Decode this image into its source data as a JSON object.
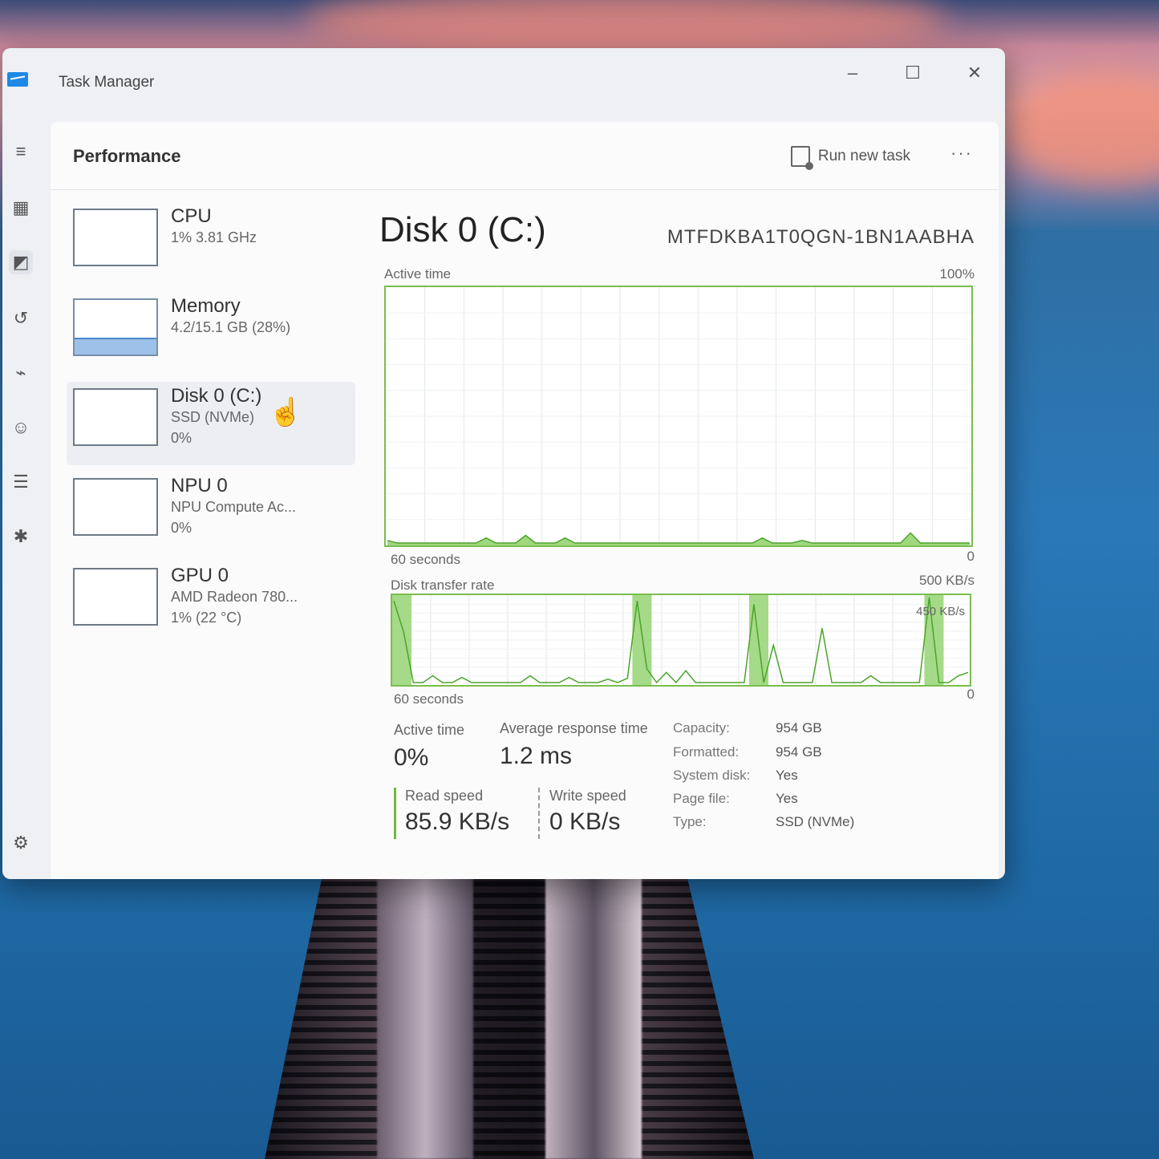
{
  "window": {
    "title": "Task Manager",
    "min_icon": "minimize-icon",
    "max_icon": "maximize-icon",
    "close_icon": "close-icon"
  },
  "nav": {
    "icons": [
      "hamburger-icon",
      "processes-icon",
      "performance-icon",
      "app-history-icon",
      "startup-icon",
      "users-icon",
      "details-icon",
      "services-icon"
    ],
    "settings_icon": "settings-icon"
  },
  "header": {
    "title": "Performance",
    "run_task_label": "Run new task",
    "more_label": "···"
  },
  "devices": [
    {
      "name": "CPU",
      "sub": "1% 3.81 GHz",
      "val": ""
    },
    {
      "name": "Memory",
      "sub": "4.2/15.1 GB (28%)",
      "val": "",
      "fill": 0.28
    },
    {
      "name": "Disk 0 (C:)",
      "sub": "SSD (NVMe)",
      "val": "0%"
    },
    {
      "name": "NPU 0",
      "sub": "NPU Compute Ac...",
      "val": "0%"
    },
    {
      "name": "GPU 0",
      "sub": "AMD Radeon 780...",
      "val": "1% (22 °C)"
    }
  ],
  "detail": {
    "title": "Disk 0 (C:)",
    "model": "MTFDKBA1T0QGN-1BN1AABHA",
    "chart1": {
      "label": "Active time",
      "max": "100%",
      "time": "60 seconds",
      "min": "0"
    },
    "chart2": {
      "label": "Disk transfer rate",
      "max": "500 KB/s",
      "mid": "450 KB/s",
      "time": "60 seconds",
      "min": "0"
    },
    "stats": {
      "active_label": "Active time",
      "active_value": "0%",
      "resp_label": "Average response time",
      "resp_value": "1.2 ms",
      "read_label": "Read speed",
      "read_value": "85.9 KB/s",
      "write_label": "Write speed",
      "write_value": "0 KB/s"
    },
    "props": [
      {
        "k": "Capacity:",
        "v": "954 GB"
      },
      {
        "k": "Formatted:",
        "v": "954 GB"
      },
      {
        "k": "System disk:",
        "v": "Yes"
      },
      {
        "k": "Page file:",
        "v": "Yes"
      },
      {
        "k": "Type:",
        "v": "SSD (NVMe)"
      }
    ]
  },
  "chart_data": [
    {
      "type": "area",
      "title": "Active time",
      "ylim": [
        0,
        100
      ],
      "x": [
        0,
        1,
        2,
        3,
        4,
        5,
        6,
        7,
        8,
        9,
        10,
        11,
        12,
        13,
        14,
        15,
        16,
        17,
        18,
        19,
        20,
        21,
        22,
        23,
        24,
        25,
        26,
        27,
        28,
        29,
        30,
        31,
        32,
        33,
        34,
        35,
        36,
        37,
        38,
        39,
        40,
        41,
        42,
        43,
        44,
        45,
        46,
        47,
        48,
        49,
        50,
        51,
        52,
        53,
        54,
        55,
        56,
        57,
        58,
        59
      ],
      "series": [
        {
          "values": [
            1,
            0,
            0,
            0,
            0,
            0,
            0,
            0,
            0,
            0,
            2,
            0,
            0,
            0,
            3,
            0,
            0,
            0,
            2,
            0,
            0,
            0,
            0,
            0,
            0,
            0,
            0,
            0,
            0,
            0,
            0,
            0,
            0,
            0,
            0,
            0,
            0,
            0,
            2,
            0,
            0,
            0,
            1,
            0,
            0,
            0,
            0,
            0,
            0,
            0,
            0,
            0,
            0,
            4,
            0,
            0,
            0,
            0,
            0,
            0
          ]
        }
      ]
    },
    {
      "type": "line",
      "title": "Disk transfer rate",
      "ylim": [
        0,
        500
      ],
      "x": [
        0,
        1,
        2,
        3,
        4,
        5,
        6,
        7,
        8,
        9,
        10,
        11,
        12,
        13,
        14,
        15,
        16,
        17,
        18,
        19,
        20,
        21,
        22,
        23,
        24,
        25,
        26,
        27,
        28,
        29,
        30,
        31,
        32,
        33,
        34,
        35,
        36,
        37,
        38,
        39,
        40,
        41,
        42,
        43,
        44,
        45,
        46,
        47,
        48,
        49,
        50,
        51,
        52,
        53,
        54,
        55,
        56,
        57,
        58,
        59
      ],
      "series": [
        {
          "values": [
            480,
            300,
            0,
            0,
            40,
            0,
            0,
            30,
            0,
            0,
            0,
            0,
            0,
            0,
            40,
            0,
            0,
            0,
            30,
            0,
            0,
            0,
            20,
            0,
            25,
            480,
            80,
            0,
            60,
            0,
            70,
            0,
            0,
            0,
            0,
            0,
            0,
            460,
            0,
            220,
            0,
            0,
            0,
            0,
            320,
            0,
            0,
            0,
            0,
            40,
            0,
            0,
            0,
            0,
            0,
            500,
            0,
            0,
            40,
            60
          ]
        }
      ]
    }
  ]
}
